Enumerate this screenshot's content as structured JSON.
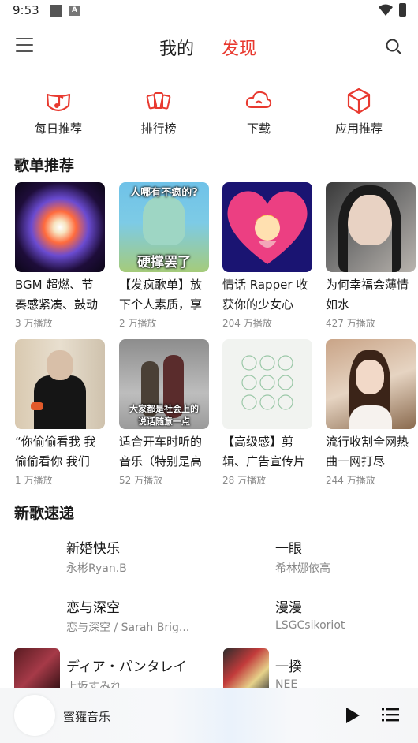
{
  "status": {
    "time": "9:53"
  },
  "header": {
    "tab_mine": "我的",
    "tab_discover": "发现",
    "accent": "#e8392f"
  },
  "quick": [
    {
      "label": "每日推荐",
      "icon": "daily-music-icon"
    },
    {
      "label": "排行榜",
      "icon": "ranking-cards-icon"
    },
    {
      "label": "下载",
      "icon": "cloud-download-icon"
    },
    {
      "label": "应用推荐",
      "icon": "cube-icon"
    }
  ],
  "playlists_title": "歌单推荐",
  "playlists": [
    {
      "name": "BGM 超燃、节奏感紧凑、鼓动",
      "plays": "3 万播放"
    },
    {
      "name": "【发疯歌单】放下个人素质，享",
      "plays": "2 万播放",
      "caption_top": "人哪有不疯的?",
      "caption_bottom": "硬撑罢了"
    },
    {
      "name": "情话 Rapper 收获你的少女心",
      "plays": "204 万播放"
    },
    {
      "name": "为何幸福会薄情如水",
      "plays": "427 万播放"
    },
    {
      "name": "“你偷偷看我 我偷偷看你 我们",
      "plays": "1 万播放"
    },
    {
      "name": "适合开车时听的音乐（特别是高",
      "plays": "52 万播放",
      "caption_top": "大家都是社会上的",
      "caption_bottom": "说话随意一点"
    },
    {
      "name": "【高级感】剪辑、广告宣传片",
      "plays": "28 万播放"
    },
    {
      "name": "流行收割全网热曲一网打尽",
      "plays": "244 万播放"
    }
  ],
  "newsongs_title": "新歌速递",
  "songs": [
    {
      "title": "新婚快乐",
      "artist": "永彬Ryan.B"
    },
    {
      "title": "一眼",
      "artist": "希林娜依高"
    },
    {
      "title": "恋与深空",
      "artist": "恋与深空 / Sarah Brig..."
    },
    {
      "title": "漫漫",
      "artist": "LSGCsikoriot"
    },
    {
      "title": "ディア・パンタレイ",
      "artist": "上坂すみれ"
    },
    {
      "title": "一揆",
      "artist": "NEE"
    }
  ],
  "player": {
    "title": "蜜獾音乐"
  }
}
